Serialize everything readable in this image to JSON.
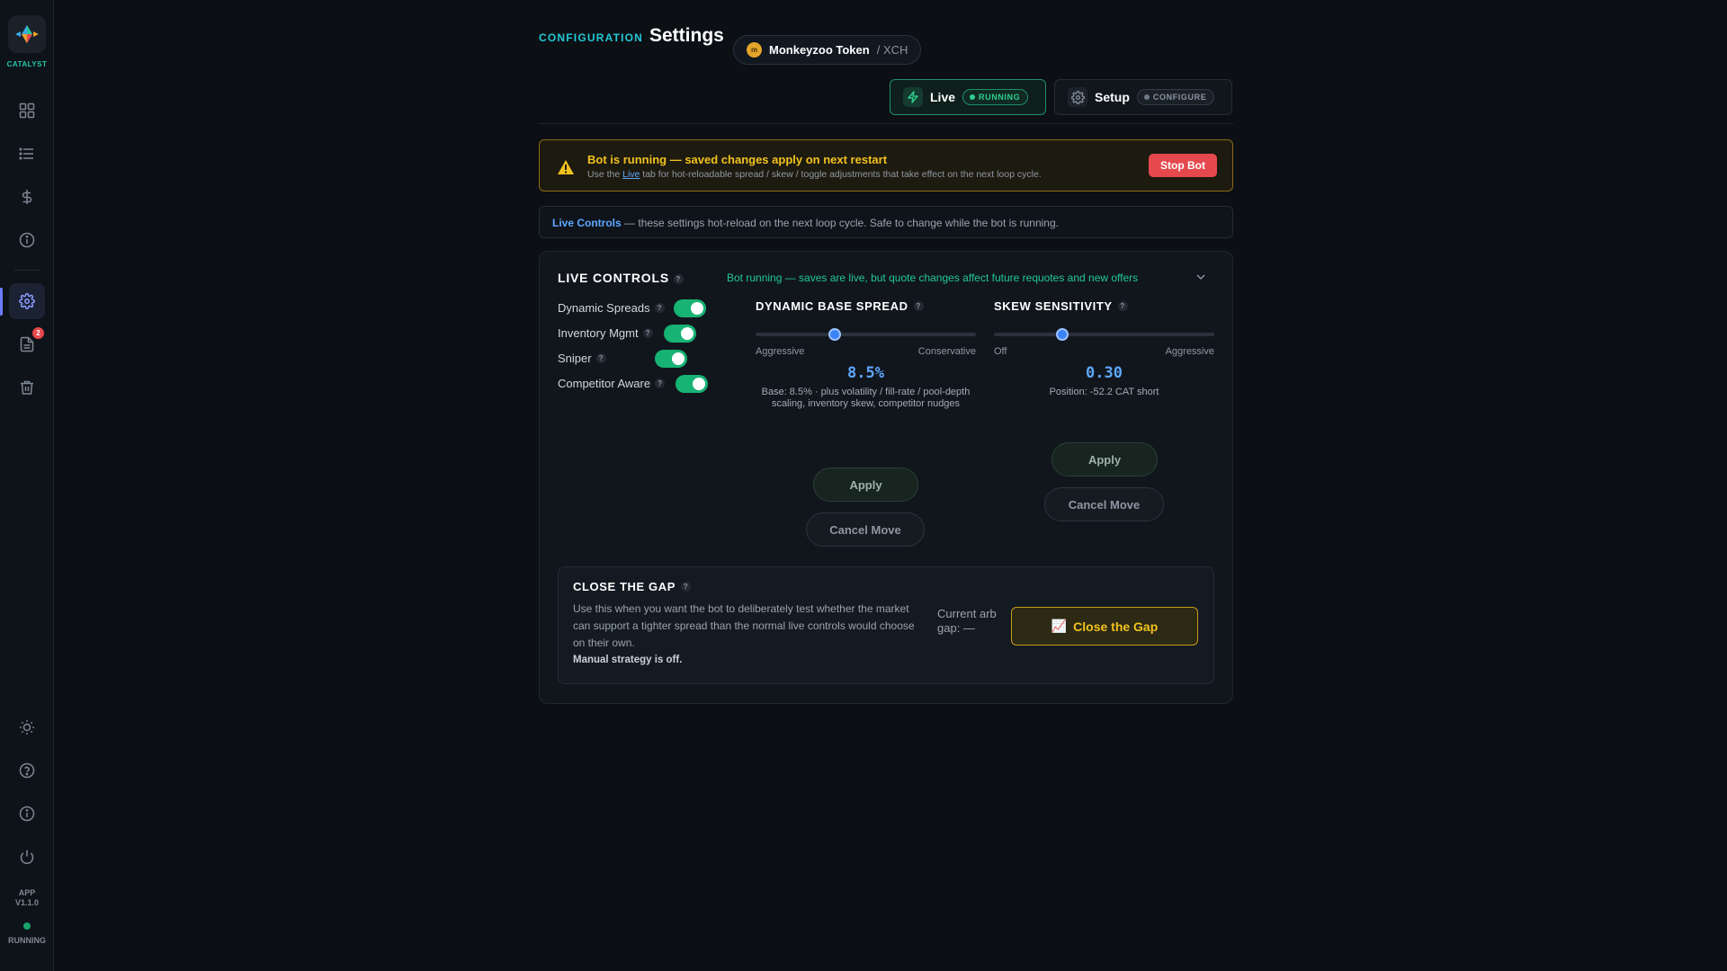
{
  "sidebar": {
    "logo_text": "CATALYST",
    "notification_count": "2",
    "app_version_line1": "APP",
    "app_version_line2": "V1.1.0",
    "status_text": "RUNNING",
    "nav_icons": [
      "grid-icon",
      "list-icon",
      "dollar-icon",
      "info-icon",
      "settings-icon",
      "document-icon",
      "trash-icon"
    ],
    "bottom_icons": [
      "sun-icon",
      "help-icon",
      "info-icon",
      "power-icon"
    ]
  },
  "header": {
    "section": "CONFIGURATION",
    "title": "Settings",
    "token": {
      "icon_glyph": "m",
      "name": "Monkeyzoo Token",
      "pair": "/ XCH"
    }
  },
  "modes": {
    "live": {
      "label": "Live",
      "badge": "RUNNING"
    },
    "setup": {
      "label": "Setup",
      "badge": "CONFIGURE"
    }
  },
  "warning": {
    "title": "Bot is running — saved changes apply on next restart",
    "desc_prefix": "Use the ",
    "desc_link": "Live",
    "desc_suffix": " tab for hot-reloadable spread / skew / toggle adjustments that take effect on the next loop cycle.",
    "stop_button": "Stop Bot"
  },
  "info_banner": {
    "highlight": "Live Controls",
    "text": " — these settings hot-reload on the next loop cycle. Safe to change while the bot is running."
  },
  "live_controls": {
    "title": "LIVE CONTROLS",
    "status": "Bot running — saves are live, but quote changes affect future requotes and new offers",
    "toggles": [
      {
        "label": "Dynamic Spreads",
        "on": true
      },
      {
        "label": "Inventory Mgmt",
        "on": true
      },
      {
        "label": "Sniper",
        "on": true
      },
      {
        "label": "Competitor Aware",
        "on": true
      }
    ],
    "dynamic_base_spread": {
      "title": "DYNAMIC BASE SPREAD",
      "min_label": "Aggressive",
      "max_label": "Conservative",
      "slider_fraction": 0.36,
      "value": "8.5%",
      "note": "Base: 8.5% · plus volatility / fill-rate / pool-depth scaling, inventory skew, competitor nudges",
      "apply": "Apply",
      "cancel": "Cancel Move"
    },
    "skew_sensitivity": {
      "title": "SKEW SENSITIVITY",
      "min_label": "Off",
      "max_label": "Aggressive",
      "slider_fraction": 0.31,
      "value": "0.30",
      "note": "Position: -52.2 CAT short",
      "apply": "Apply",
      "cancel": "Cancel Move"
    }
  },
  "close_gap": {
    "title": "CLOSE THE GAP",
    "description": "Use this when you want the bot to deliberately test whether the market can support a tighter spread than the normal live controls would choose on their own.",
    "note": "Manual strategy is off.",
    "arb_label": "Current arb gap: —",
    "button": "Close the Gap",
    "button_icon": "📈"
  },
  "colors": {
    "accent": "#22c9d6",
    "running": "#17b374",
    "warning": "#f2c21f",
    "danger": "#e5484d",
    "value": "#5ea8ff"
  }
}
